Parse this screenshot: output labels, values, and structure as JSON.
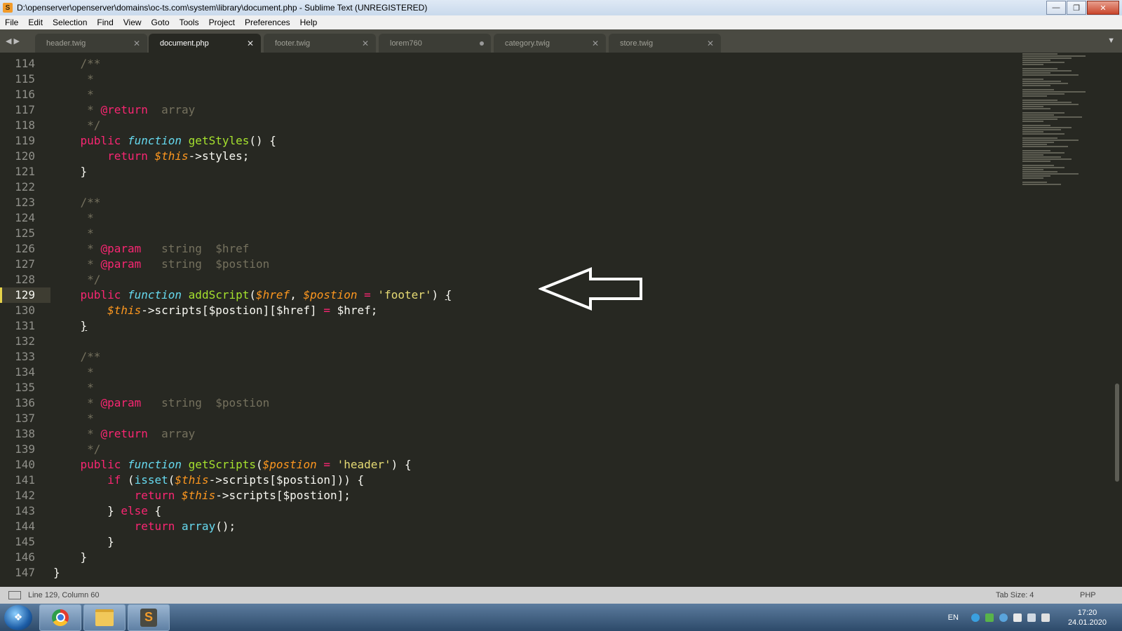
{
  "window": {
    "title": "D:\\openserver\\openserver\\domains\\oc-ts.com\\system\\library\\document.php - Sublime Text (UNREGISTERED)"
  },
  "menu": [
    "File",
    "Edit",
    "Selection",
    "Find",
    "View",
    "Goto",
    "Tools",
    "Project",
    "Preferences",
    "Help"
  ],
  "tabs": [
    {
      "label": "header.twig",
      "active": false,
      "dirty": false
    },
    {
      "label": "document.php",
      "active": true,
      "dirty": false
    },
    {
      "label": "footer.twig",
      "active": false,
      "dirty": false
    },
    {
      "label": "lorem760",
      "active": false,
      "dirty": true
    },
    {
      "label": "category.twig",
      "active": false,
      "dirty": false
    },
    {
      "label": "store.twig",
      "active": false,
      "dirty": false
    }
  ],
  "editor": {
    "current_line": 129,
    "lines": [
      {
        "n": "114",
        "t": [
          [
            "cm",
            "    /**"
          ]
        ]
      },
      {
        "n": "115",
        "t": [
          [
            "cm",
            "     *"
          ]
        ]
      },
      {
        "n": "116",
        "t": [
          [
            "cm",
            "     *"
          ]
        ]
      },
      {
        "n": "117",
        "t": [
          [
            "cm",
            "     * "
          ],
          [
            "tg",
            "@return"
          ],
          [
            "cm",
            "  array"
          ]
        ]
      },
      {
        "n": "118",
        "t": [
          [
            "cm",
            "     */"
          ]
        ]
      },
      {
        "n": "119",
        "t": [
          [
            "kw",
            "    public "
          ],
          [
            "sc",
            "function "
          ],
          [
            "fn",
            "getStyles"
          ],
          [
            "",
            "() {"
          ]
        ]
      },
      {
        "n": "120",
        "t": [
          [
            "kw",
            "        return "
          ],
          [
            "va",
            "$this"
          ],
          [
            "",
            "->styles;"
          ]
        ]
      },
      {
        "n": "121",
        "t": [
          [
            "",
            "    }"
          ]
        ]
      },
      {
        "n": "122",
        "t": [
          [
            "",
            ""
          ]
        ]
      },
      {
        "n": "123",
        "t": [
          [
            "cm",
            "    /**"
          ]
        ]
      },
      {
        "n": "124",
        "t": [
          [
            "cm",
            "     *"
          ]
        ]
      },
      {
        "n": "125",
        "t": [
          [
            "cm",
            "     *"
          ]
        ]
      },
      {
        "n": "126",
        "t": [
          [
            "cm",
            "     * "
          ],
          [
            "tg",
            "@param"
          ],
          [
            "cm",
            "   string  $href"
          ]
        ]
      },
      {
        "n": "127",
        "t": [
          [
            "cm",
            "     * "
          ],
          [
            "tg",
            "@param"
          ],
          [
            "cm",
            "   string  $postion"
          ]
        ]
      },
      {
        "n": "128",
        "t": [
          [
            "cm",
            "     */"
          ]
        ]
      },
      {
        "n": "129",
        "t": [
          [
            "kw",
            "    public "
          ],
          [
            "sc",
            "function "
          ],
          [
            "fn",
            "addScript"
          ],
          [
            "",
            "("
          ],
          [
            "va",
            "$href"
          ],
          [
            "",
            ", "
          ],
          [
            "va",
            "$postion"
          ],
          [
            "kw",
            " = "
          ],
          [
            "st",
            "'footer'"
          ],
          [
            "",
            ") "
          ],
          [
            "ul",
            "{"
          ]
        ]
      },
      {
        "n": "130",
        "t": [
          [
            "va",
            "        $this"
          ],
          [
            "",
            "->scripts[$postion][$href] "
          ],
          [
            "kw",
            "="
          ],
          [
            "",
            " $href;"
          ]
        ]
      },
      {
        "n": "131",
        "t": [
          [
            "",
            "    "
          ],
          [
            "ul",
            "}"
          ]
        ]
      },
      {
        "n": "132",
        "t": [
          [
            "",
            ""
          ]
        ]
      },
      {
        "n": "133",
        "t": [
          [
            "cm",
            "    /**"
          ]
        ]
      },
      {
        "n": "134",
        "t": [
          [
            "cm",
            "     *"
          ]
        ]
      },
      {
        "n": "135",
        "t": [
          [
            "cm",
            "     *"
          ]
        ]
      },
      {
        "n": "136",
        "t": [
          [
            "cm",
            "     * "
          ],
          [
            "tg",
            "@param"
          ],
          [
            "cm",
            "   string  $postion"
          ]
        ]
      },
      {
        "n": "137",
        "t": [
          [
            "cm",
            "     *"
          ]
        ]
      },
      {
        "n": "138",
        "t": [
          [
            "cm",
            "     * "
          ],
          [
            "tg",
            "@return"
          ],
          [
            "cm",
            "  array"
          ]
        ]
      },
      {
        "n": "139",
        "t": [
          [
            "cm",
            "     */"
          ]
        ]
      },
      {
        "n": "140",
        "t": [
          [
            "kw",
            "    public "
          ],
          [
            "sc",
            "function "
          ],
          [
            "fn",
            "getScripts"
          ],
          [
            "",
            "("
          ],
          [
            "va",
            "$postion"
          ],
          [
            "kw",
            " = "
          ],
          [
            "st",
            "'header'"
          ],
          [
            "",
            ") {"
          ]
        ]
      },
      {
        "n": "141",
        "t": [
          [
            "kw",
            "        if "
          ],
          [
            "",
            "("
          ],
          [
            "bi",
            "isset"
          ],
          [
            "",
            "("
          ],
          [
            "va",
            "$this"
          ],
          [
            "",
            "->scripts[$postion])) {"
          ]
        ]
      },
      {
        "n": "142",
        "t": [
          [
            "kw",
            "            return "
          ],
          [
            "va",
            "$this"
          ],
          [
            "",
            "->scripts[$postion];"
          ]
        ]
      },
      {
        "n": "143",
        "t": [
          [
            "",
            "        } "
          ],
          [
            "kw",
            "else"
          ],
          [
            "",
            " {"
          ]
        ]
      },
      {
        "n": "144",
        "t": [
          [
            "kw",
            "            return "
          ],
          [
            "bi",
            "array"
          ],
          [
            "",
            "();"
          ]
        ]
      },
      {
        "n": "145",
        "t": [
          [
            "",
            "        }"
          ]
        ]
      },
      {
        "n": "146",
        "t": [
          [
            "",
            "    }"
          ]
        ]
      },
      {
        "n": "147",
        "t": [
          [
            "",
            "}"
          ]
        ]
      }
    ]
  },
  "status": {
    "position": "Line 129, Column 60",
    "tab_size": "Tab Size: 4",
    "syntax": "PHP"
  },
  "taskbar": {
    "lang": "EN",
    "time": "17:20",
    "date": "24.01.2020"
  },
  "colors": {
    "background": "#272822",
    "comment": "#75715e",
    "keyword": "#f92672",
    "function": "#a6e22e",
    "variable": "#fd971f",
    "string": "#e6db74",
    "storage": "#66d9ef"
  }
}
